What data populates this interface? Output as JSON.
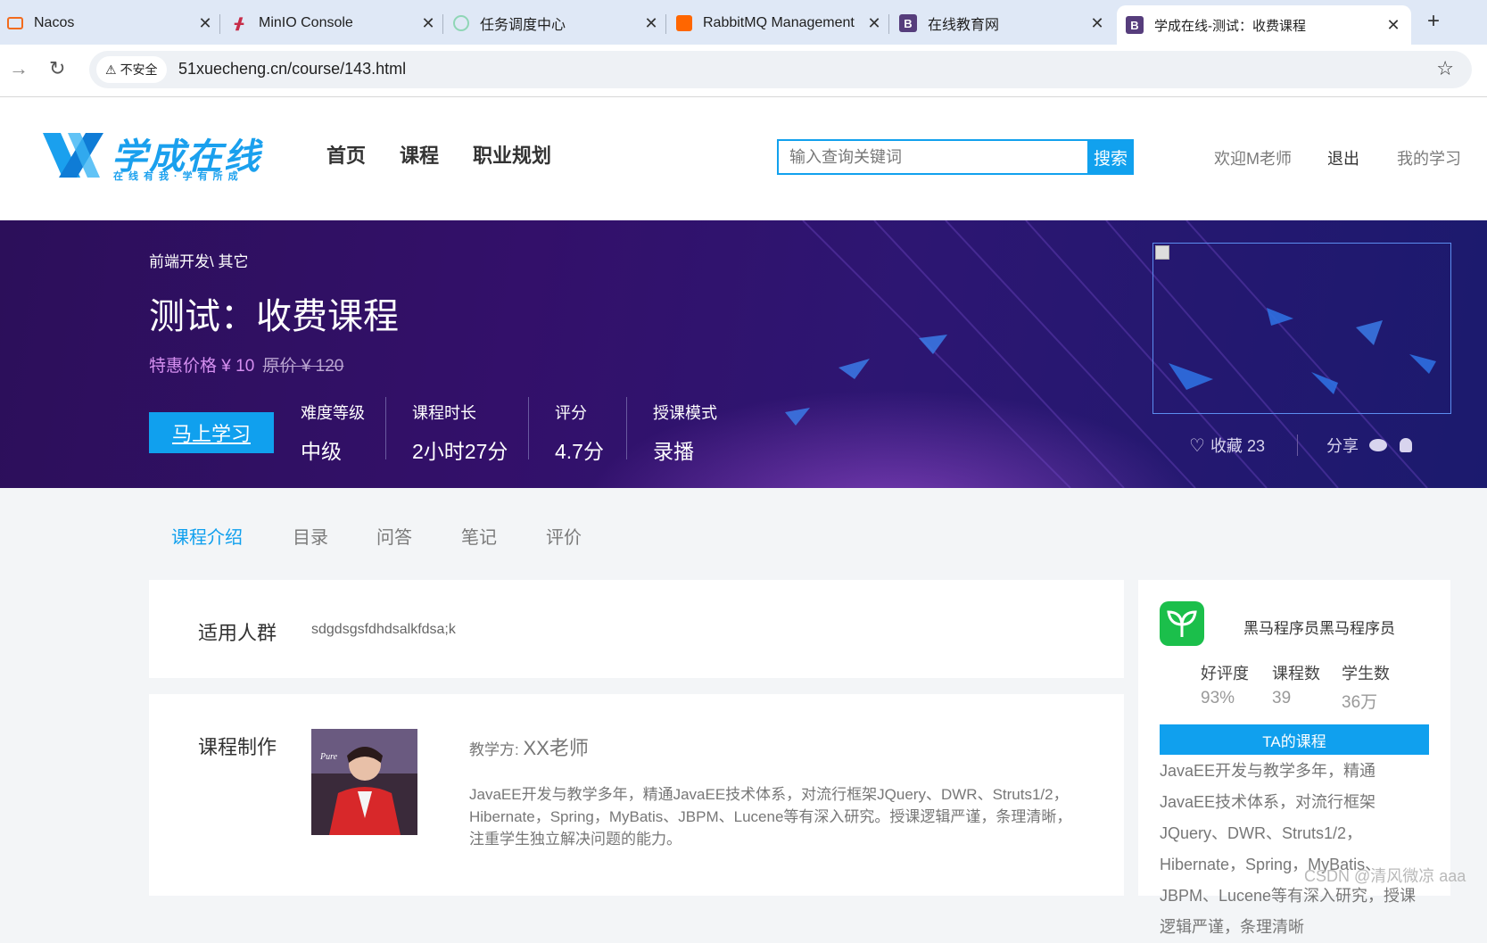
{
  "browser": {
    "tabs": [
      {
        "label": "Nacos",
        "icon": "nacos-icon"
      },
      {
        "label": "MinIO Console",
        "icon": "minio-icon"
      },
      {
        "label": "任务调度中心",
        "icon": "xxl-job-icon"
      },
      {
        "label": "RabbitMQ Management",
        "icon": "rabbitmq-icon"
      },
      {
        "label": "在线教育网",
        "icon": "bootstrap-icon"
      },
      {
        "label": "学成在线-测试：收费课程",
        "icon": "bootstrap-icon",
        "active": true
      }
    ],
    "security_label": "不安全",
    "url": "51xuecheng.cn/course/143.html"
  },
  "header": {
    "logo_text": "学成在线",
    "logo_subtext": "在线有我·学有所成",
    "nav": [
      "首页",
      "课程",
      "职业规划"
    ],
    "search_placeholder": "输入查询关键词",
    "search_button": "搜索",
    "welcome": "欢迎M老师",
    "logout": "退出",
    "my_learning": "我的学习"
  },
  "banner": {
    "breadcrumb": "前端开发\\ 其它",
    "title": "测试：收费课程",
    "price_label": "特惠价格 ¥ 10",
    "original_price": "原价 ¥ 120",
    "learn_button": "马上学习",
    "stats": [
      {
        "label": "难度等级",
        "value": "中级"
      },
      {
        "label": "课程时长",
        "value": "2小时27分"
      },
      {
        "label": "评分",
        "value": "4.7分"
      },
      {
        "label": "授课模式",
        "value": "录播"
      }
    ],
    "favorite": "收藏 23",
    "share": "分享"
  },
  "content_tabs": [
    "课程介绍",
    "目录",
    "问答",
    "笔记",
    "评价"
  ],
  "suitable": {
    "heading": "适用人群",
    "value": "sdgdsgsfdhdsalkfdsa;k"
  },
  "production": {
    "heading": "课程制作",
    "teacher_label": "教学方:",
    "teacher_name": "XX老师",
    "teacher_desc": "JavaEE开发与教学多年，精通JavaEE技术体系，对流行框架JQuery、DWR、Struts1/2，Hibernate，Spring，MyBatis、JBPM、Lucene等有深入研究。授课逻辑严谨，条理清晰，注重学生独立解决问题的能力。"
  },
  "sidebar": {
    "org_name": "黑马程序员黑马程序员",
    "stats": [
      {
        "label": "好评度",
        "value": "93%"
      },
      {
        "label": "课程数",
        "value": "39"
      },
      {
        "label": "学生数",
        "value": "36万"
      }
    ],
    "ta_courses": "TA的课程",
    "desc": "JavaEE开发与教学多年，精通JavaEE技术体系，对流行框架JQuery、DWR、Struts1/2，Hibernate，Spring，MyBatis、JBPM、Lucene等有深入研究，授课逻辑严谨，条理清晰"
  },
  "watermark": "CSDN @清风微凉 aaa",
  "colors": {
    "accent": "#10a0ee",
    "banner_bg": "#2c0f5a",
    "price": "#d58ff0",
    "brand_green": "#1bbf4b"
  }
}
